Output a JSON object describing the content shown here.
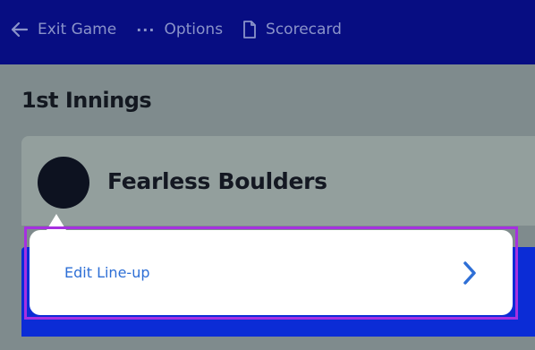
{
  "topbar": {
    "exit_label": "Exit Game",
    "options_label": "Options",
    "options_glyph": "···",
    "scorecard_label": "Scorecard"
  },
  "innings": {
    "title": "1st Innings"
  },
  "team": {
    "name": "Fearless Boulders"
  },
  "popup": {
    "edit_label": "Edit Line-up"
  },
  "colors": {
    "topbar_bg": "#070d82",
    "overlay_bg": "#7f8b8d",
    "card_bg": "#939f9d",
    "blue_bar": "#0b2cd6",
    "highlight": "#a630e0",
    "link": "#2e6fd6"
  },
  "icons": [
    "arrow-left-icon",
    "ellipsis-icon",
    "document-icon",
    "chevron-right-icon"
  ]
}
